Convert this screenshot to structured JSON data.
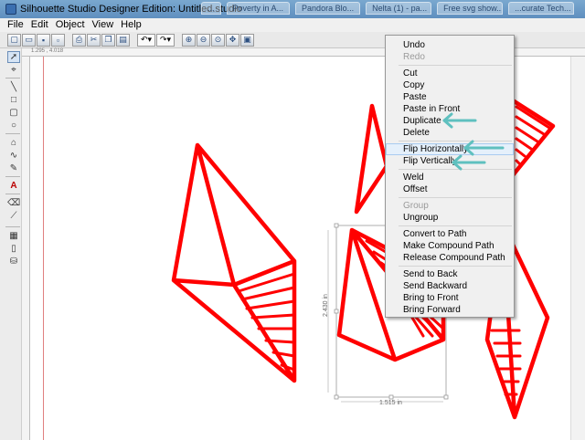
{
  "window": {
    "title": "Silhouette Studio Designer Edition: Untitled.studio",
    "background_tabs": [
      "...",
      "Poverty in A...",
      "Pandora Blo...",
      "Nelta (1) - pa...",
      "Free svg show...",
      "...curate Tech..."
    ]
  },
  "menubar": {
    "items": [
      "File",
      "Edit",
      "Object",
      "View",
      "Help"
    ]
  },
  "toolbar": {
    "icons": [
      "new-icon",
      "open-icon",
      "save-icon",
      "save-as-icon",
      "print-icon",
      "cut-icon",
      "copy-icon",
      "paste-icon",
      "undo-icon",
      "redo-icon",
      "zoom-in-icon",
      "zoom-out-icon",
      "zoom-box-icon",
      "pan-icon",
      "fit-page-icon"
    ]
  },
  "left_toolbar": {
    "icons": [
      "select-icon",
      "edit-points-icon",
      "line-icon",
      "rectangle-icon",
      "rounded-rect-icon",
      "ellipse-icon",
      "polygon-icon",
      "curve-icon",
      "freehand-icon",
      "text-icon",
      "eraser-icon",
      "knife-icon",
      "grid-icon",
      "page-icon",
      "library-icon"
    ]
  },
  "ruler": {
    "label": "1.295 , 4.018"
  },
  "canvas": {
    "shape_color": "#ff0000",
    "height_dimension": "2.430 in",
    "width_dimension": "1.515 in"
  },
  "context_menu": {
    "items": [
      {
        "label": "Undo",
        "disabled": false
      },
      {
        "label": "Redo",
        "disabled": true
      },
      {
        "label": "Cut",
        "disabled": false
      },
      {
        "label": "Copy",
        "disabled": false
      },
      {
        "label": "Paste",
        "disabled": false
      },
      {
        "label": "Paste in Front",
        "disabled": false
      },
      {
        "label": "Duplicate",
        "disabled": false
      },
      {
        "label": "Delete",
        "disabled": false
      },
      {
        "label": "Flip Horizontally",
        "disabled": false,
        "hover": true
      },
      {
        "label": "Flip Vertically",
        "disabled": false
      },
      {
        "label": "Weld",
        "disabled": false
      },
      {
        "label": "Offset",
        "disabled": false
      },
      {
        "label": "Group",
        "disabled": true
      },
      {
        "label": "Ungroup",
        "disabled": false
      },
      {
        "label": "Convert to Path",
        "disabled": false
      },
      {
        "label": "Make Compound Path",
        "disabled": false
      },
      {
        "label": "Release Compound Path",
        "disabled": false
      },
      {
        "label": "Send to Back",
        "disabled": false
      },
      {
        "label": "Send Backward",
        "disabled": false
      },
      {
        "label": "Bring to Front",
        "disabled": false
      },
      {
        "label": "Bring Forward",
        "disabled": false
      }
    ],
    "annotation_arrow_color": "#5fc0bf"
  }
}
